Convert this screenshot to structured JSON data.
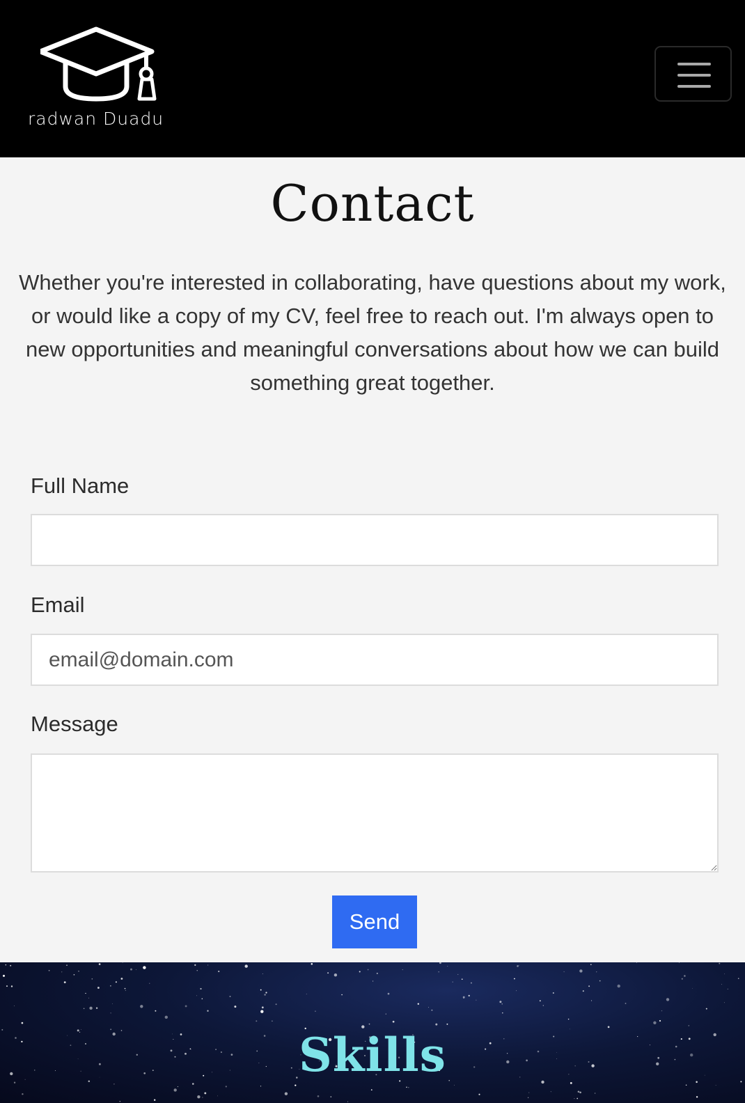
{
  "navbar": {
    "brand_name": "radwan Duadu",
    "logo_icon": "graduation-cap-icon",
    "menu_icon": "hamburger-menu-icon"
  },
  "contact": {
    "title": "Contact",
    "intro": "Whether you're interested in collaborating, have questions about my work, or would like a copy of my CV, feel free to reach out. I'm always open to new opportunities and meaningful conversations about how we can build something great together.",
    "form": {
      "name_label": "Full Name",
      "name_value": "",
      "email_label": "Email",
      "email_placeholder": "email@domain.com",
      "email_value": "",
      "message_label": "Message",
      "message_value": "",
      "send_label": "Send"
    }
  },
  "skills": {
    "title": "Skills"
  },
  "colors": {
    "navbar_bg": "#000000",
    "page_bg": "#f4f4f4",
    "button_bg": "#2f6bf2",
    "skills_title": "#7fe3e8",
    "skills_bg": "#0d1738"
  }
}
